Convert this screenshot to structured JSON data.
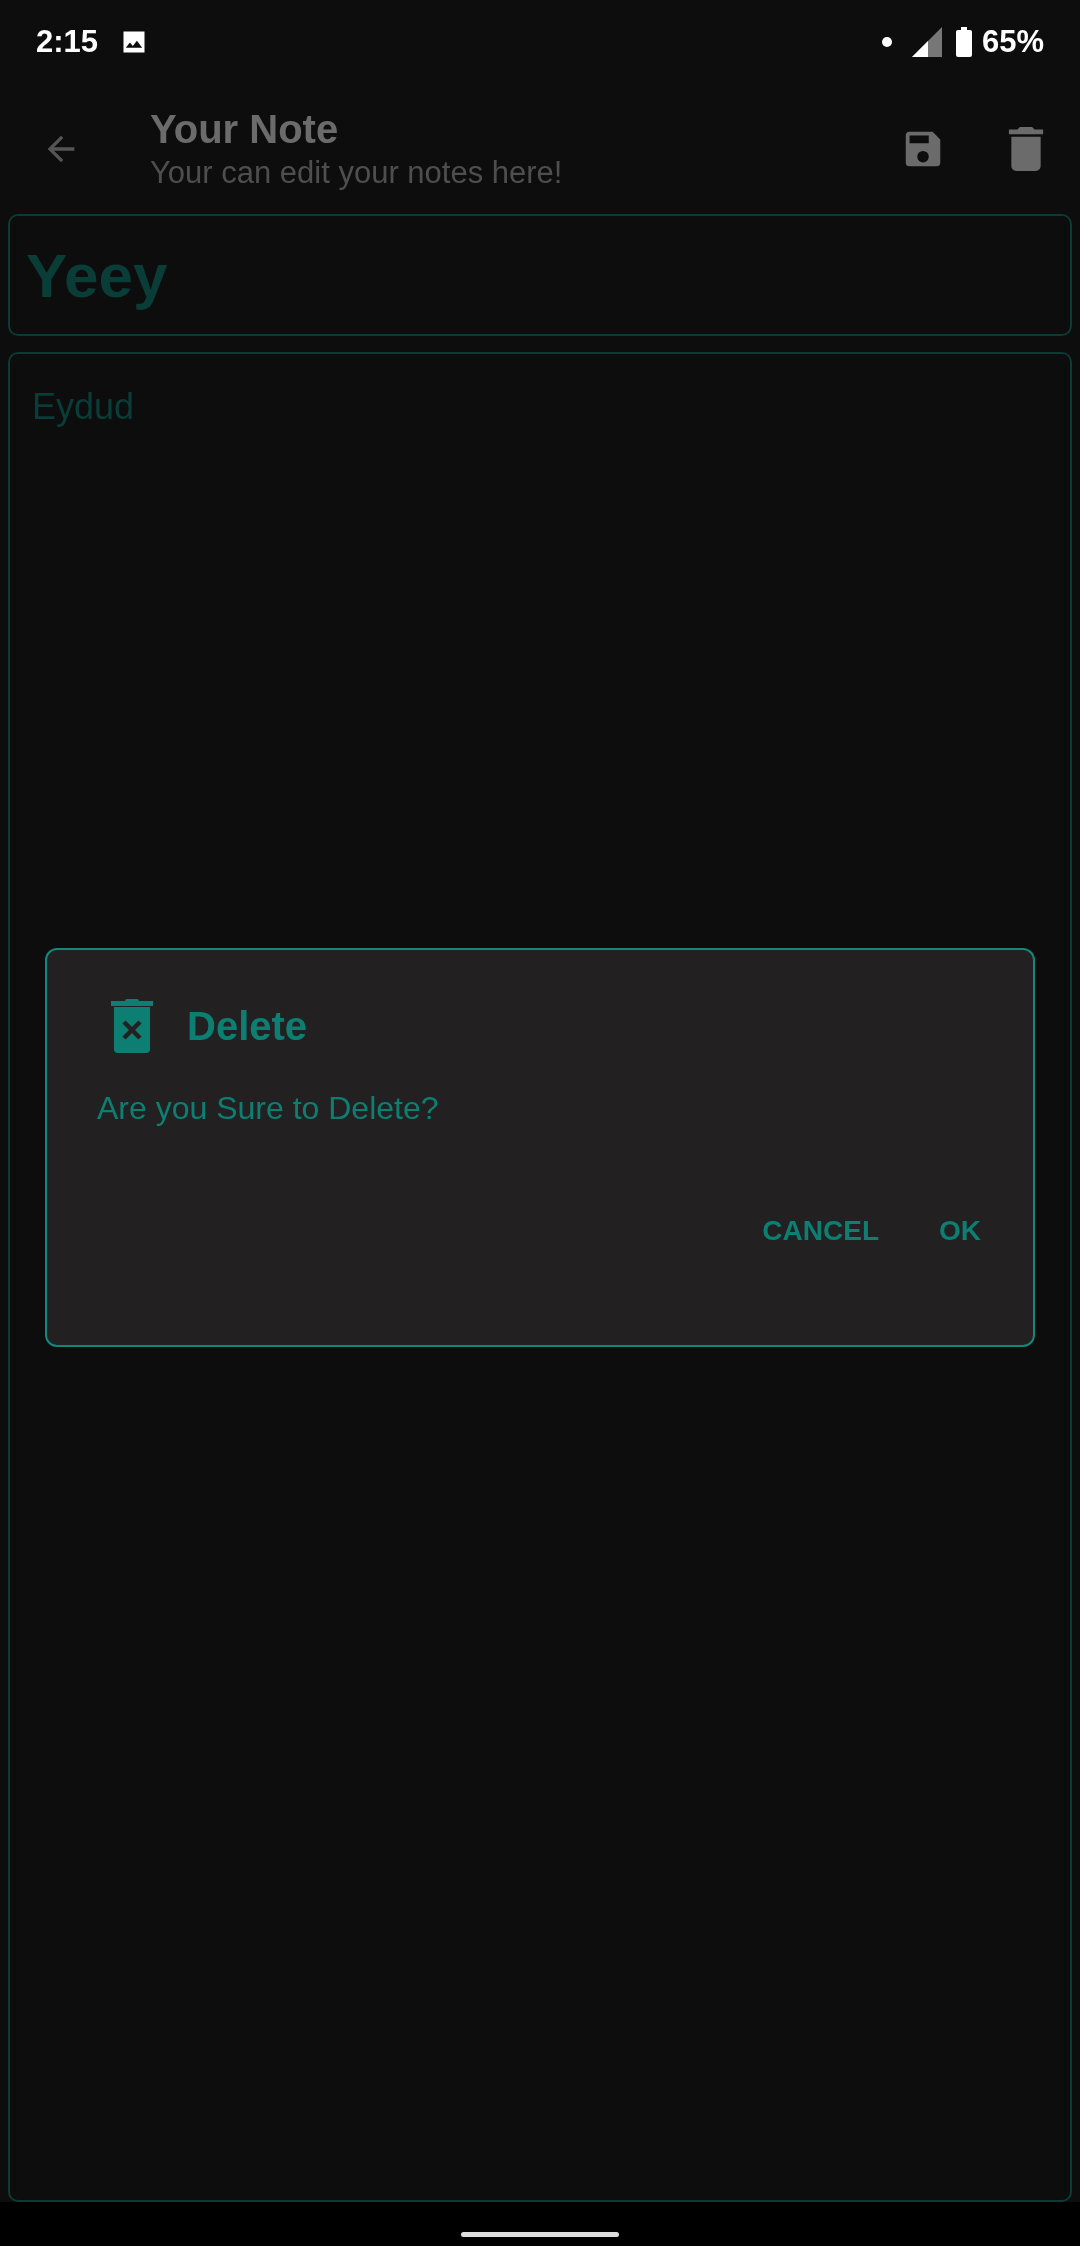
{
  "status_bar": {
    "time": "2:15",
    "battery": "65%"
  },
  "app_bar": {
    "title": "Your Note",
    "subtitle": "Your can edit your notes here!"
  },
  "note": {
    "title": "Yeey",
    "body": "Eydud"
  },
  "dialog": {
    "title": "Delete",
    "message": "Are you Sure to Delete?",
    "buttons": [
      "CANCEL",
      "OK"
    ]
  }
}
